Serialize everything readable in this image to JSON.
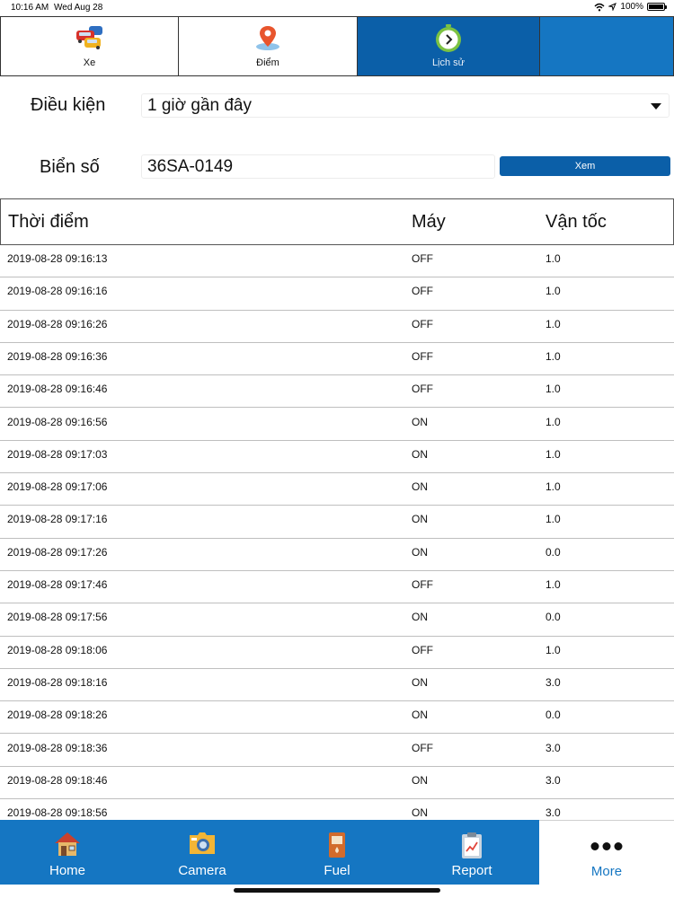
{
  "status_bar": {
    "time": "10:16 AM",
    "date": "Wed Aug 28",
    "battery": "100%",
    "battery_level": 1.0
  },
  "tabs": [
    {
      "label": "Xe",
      "icon": "cars-icon",
      "active": false
    },
    {
      "label": "Điểm",
      "icon": "map-pin-icon",
      "active": false
    },
    {
      "label": "Lịch sử",
      "icon": "clock-icon",
      "active": true
    },
    {
      "label": "",
      "icon": "",
      "active": false
    }
  ],
  "form": {
    "condition_label": "Điều kiện",
    "condition_value": "1 giờ gần đây",
    "plate_label": "Biển số",
    "plate_value": "36SA-0149",
    "view_button": "Xem"
  },
  "table": {
    "columns": [
      "Thời điểm",
      "Máy",
      "Vận tốc"
    ],
    "rows": [
      [
        "2019-08-28 09:16:13",
        "OFF",
        "1.0"
      ],
      [
        "2019-08-28 09:16:16",
        "OFF",
        "1.0"
      ],
      [
        "2019-08-28 09:16:26",
        "OFF",
        "1.0"
      ],
      [
        "2019-08-28 09:16:36",
        "OFF",
        "1.0"
      ],
      [
        "2019-08-28 09:16:46",
        "OFF",
        "1.0"
      ],
      [
        "2019-08-28 09:16:56",
        "ON",
        "1.0"
      ],
      [
        "2019-08-28 09:17:03",
        "ON",
        "1.0"
      ],
      [
        "2019-08-28 09:17:06",
        "ON",
        "1.0"
      ],
      [
        "2019-08-28 09:17:16",
        "ON",
        "1.0"
      ],
      [
        "2019-08-28 09:17:26",
        "ON",
        "0.0"
      ],
      [
        "2019-08-28 09:17:46",
        "OFF",
        "1.0"
      ],
      [
        "2019-08-28 09:17:56",
        "ON",
        "0.0"
      ],
      [
        "2019-08-28 09:18:06",
        "OFF",
        "1.0"
      ],
      [
        "2019-08-28 09:18:16",
        "ON",
        "3.0"
      ],
      [
        "2019-08-28 09:18:26",
        "ON",
        "0.0"
      ],
      [
        "2019-08-28 09:18:36",
        "OFF",
        "3.0"
      ],
      [
        "2019-08-28 09:18:46",
        "ON",
        "3.0"
      ],
      [
        "2019-08-28 09:18:56",
        "ON",
        "3.0"
      ]
    ]
  },
  "bottom_tabs": [
    {
      "label": "Home",
      "icon": "home-icon"
    },
    {
      "label": "Camera",
      "icon": "camera-icon"
    },
    {
      "label": "Fuel",
      "icon": "fuel-pump-icon"
    },
    {
      "label": "Report",
      "icon": "report-clipboard-icon"
    },
    {
      "label": "More",
      "icon": "more-dots-icon",
      "selected": true
    }
  ],
  "colors": {
    "accent": "#0b5fa8",
    "tabbar": "#1576c2",
    "more_label": "#1576c2"
  }
}
